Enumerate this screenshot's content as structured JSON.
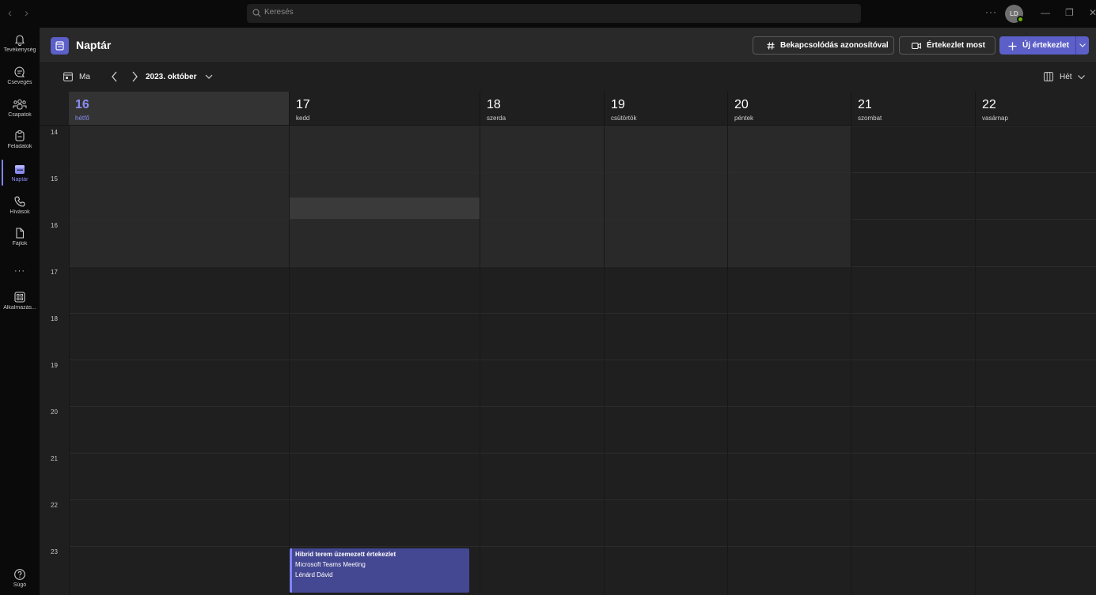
{
  "titlebar": {
    "search_placeholder": "Keresés",
    "avatar_initials": "LD",
    "more": "···",
    "minimize": "—",
    "restore": "❐",
    "close": "✕"
  },
  "rail": {
    "items": [
      {
        "label": "Tevékenység",
        "icon": "bell-icon"
      },
      {
        "label": "Csevegés",
        "icon": "chat-icon"
      },
      {
        "label": "Csapatok",
        "icon": "teams-icon"
      },
      {
        "label": "Feladatok",
        "icon": "tasks-icon"
      },
      {
        "label": "Naptár",
        "icon": "calendar-icon",
        "active": true
      },
      {
        "label": "Hívások",
        "icon": "phone-icon"
      },
      {
        "label": "Fájlok",
        "icon": "file-icon"
      },
      {
        "label": "···",
        "icon": "more-icon"
      },
      {
        "label": "Alkalmazás...",
        "icon": "apps-icon"
      }
    ],
    "help_label": "Súgó"
  },
  "header": {
    "title": "Naptár",
    "join_by_id": "Bekapcsolódás azonosítóval",
    "meet_now": "Értekezlet most",
    "new_meeting": "Új értekezlet"
  },
  "toolbar": {
    "today": "Ma",
    "month": "2023. október",
    "view": "Hét"
  },
  "days": [
    {
      "num": "16",
      "name": "hétfő",
      "today": true
    },
    {
      "num": "17",
      "name": "kedd"
    },
    {
      "num": "18",
      "name": "szerda"
    },
    {
      "num": "19",
      "name": "csütörtök"
    },
    {
      "num": "20",
      "name": "péntek"
    },
    {
      "num": "21",
      "name": "szombat"
    },
    {
      "num": "22",
      "name": "vasárnap"
    }
  ],
  "hours": [
    "14",
    "15",
    "16",
    "17",
    "18",
    "19",
    "20",
    "21",
    "22",
    "23"
  ],
  "event": {
    "title": "Hibrid terem üzemezett értekezlet",
    "line1": "Microsoft Teams Meeting",
    "line2": "Lénárd Dávid"
  },
  "colors": {
    "accent": "#5b5fc7",
    "accent_light": "#7f85f5",
    "event_bg": "#444791",
    "presence": "#6bb700"
  }
}
